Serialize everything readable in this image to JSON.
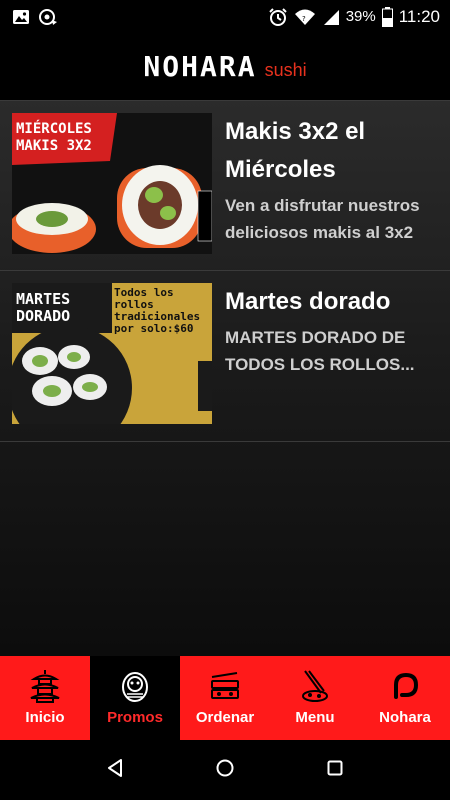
{
  "status_bar": {
    "battery_percent": "39%",
    "time": "11:20",
    "icons": [
      "image-icon",
      "sync-icon",
      "alarm-icon",
      "wifi-icon",
      "signal-icon",
      "battery-icon"
    ]
  },
  "header": {
    "logo_text": "NOHARA",
    "logo_sub": "sushi"
  },
  "promos": [
    {
      "title": "Makis 3x2 el Miércoles",
      "description": "Ven a disfrutar nuestros deliciosos makis al 3x2",
      "image_text_1": "MIÉRCOLES",
      "image_text_2": "MAKIS 3X2"
    },
    {
      "title": "Martes dorado",
      "description": "MARTES DORADO DE TODOS LOS ROLLOS...",
      "image_text_1": "MARTES",
      "image_text_2": "DORADO",
      "image_text_3": "Todos los rollos tradicionales por solo:$60"
    }
  ],
  "bottom_nav": {
    "items": [
      {
        "label": "Inicio",
        "icon": "pagoda-icon",
        "active": false
      },
      {
        "label": "Promos",
        "icon": "daruma-icon",
        "active": true
      },
      {
        "label": "Ordenar",
        "icon": "bento-icon",
        "active": false
      },
      {
        "label": "Menu",
        "icon": "chopsticks-icon",
        "active": false
      },
      {
        "label": "Nohara",
        "icon": "nohara-logo-icon",
        "active": false
      }
    ]
  },
  "colors": {
    "accent": "#ff1a1a",
    "background": "#000000"
  }
}
